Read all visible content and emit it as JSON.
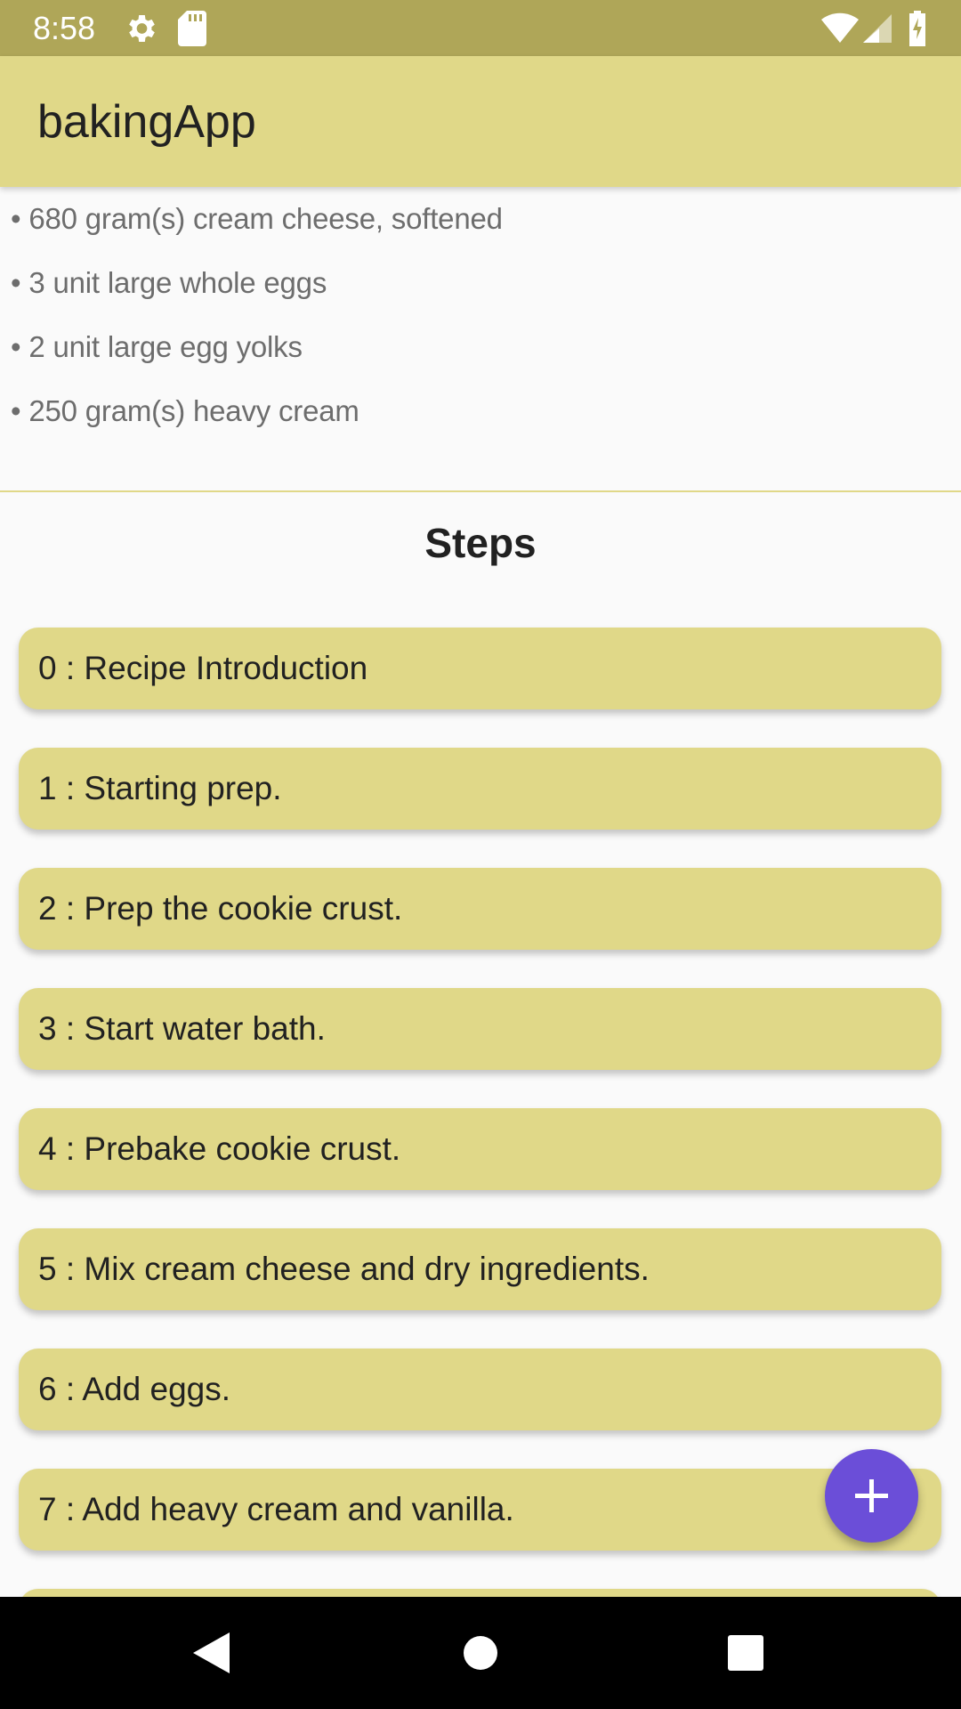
{
  "status_bar": {
    "time": "8:58",
    "background_color": "#afa658",
    "icons": [
      "settings-gear-icon",
      "sd-card-icon",
      "wifi-icon",
      "cell-signal-icon",
      "battery-charging-icon"
    ]
  },
  "app_bar": {
    "title": "bakingApp",
    "background_color": "#e0d888"
  },
  "ingredients": [
    "• 680 gram(s) cream cheese, softened",
    "• 3 unit large whole eggs",
    "• 2 unit large egg yolks",
    "• 250 gram(s) heavy cream"
  ],
  "steps": {
    "heading": "Steps",
    "items": [
      "0 : Recipe Introduction",
      "1 : Starting prep.",
      "2 : Prep the cookie crust.",
      "3 : Start water bath.",
      "4 : Prebake cookie crust.",
      "5 : Mix cream cheese and dry ingredients.",
      "6 : Add eggs.",
      "7 : Add heavy cream and vanilla."
    ],
    "card_color": "#e0d888"
  },
  "fab": {
    "icon": "plus-icon",
    "color": "#6b4ed8"
  },
  "nav_bar": {
    "buttons": [
      "back-icon",
      "home-icon",
      "recents-icon"
    ]
  }
}
